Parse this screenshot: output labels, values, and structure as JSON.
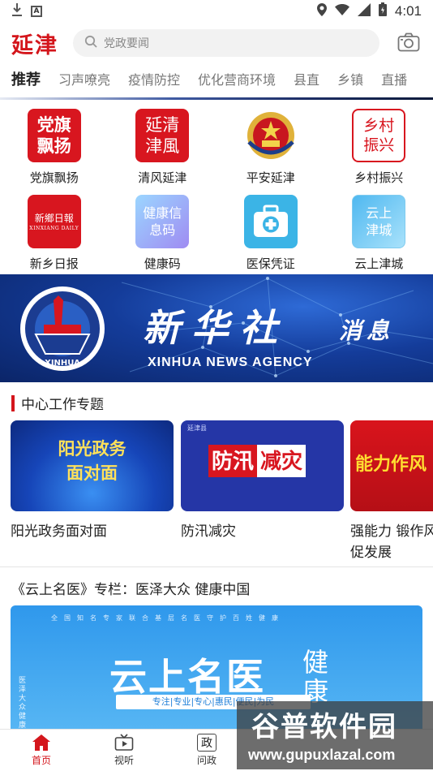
{
  "status_bar": {
    "time": "4:01",
    "notify_a": "A"
  },
  "header": {
    "logo": "延津",
    "search_placeholder": "党政要闻"
  },
  "tabs": [
    "推荐",
    "习声嘹亮",
    "疫情防控",
    "优化营商环境",
    "县直",
    "乡镇",
    "直播"
  ],
  "grid": [
    {
      "label": "党旗飘扬",
      "icon_text": "党旗飘扬",
      "icon": "party-flag-icon"
    },
    {
      "label": "清风延津",
      "icon_text": "延清津風",
      "icon": "clean-wind-icon"
    },
    {
      "label": "平安延津",
      "icon": "police-emblem-icon"
    },
    {
      "label": "乡村振兴",
      "icon_text": "乡村振兴",
      "icon": "rural-revitalization-icon"
    },
    {
      "label": "新乡日报",
      "icon_text": "新鄉日報",
      "icon_sub": "XINXIANG DAILY",
      "icon": "newspaper-icon"
    },
    {
      "label": "健康码",
      "icon_text": "健康信息码",
      "icon": "health-code-icon"
    },
    {
      "label": "医保凭证",
      "icon": "medical-kit-icon"
    },
    {
      "label": "云上津城",
      "icon_text": "云上津城",
      "icon": "cloud-city-icon"
    }
  ],
  "banner": {
    "title": "新华社",
    "title2": "消息",
    "subtitle": "XINHUA NEWS AGENCY",
    "emblem_text": "XINHUA"
  },
  "section": {
    "title": "中心工作专题"
  },
  "topics": [
    {
      "title": "阳光政务面对面",
      "card_line1": "阳光政务",
      "card_line2": "面对面"
    },
    {
      "title": "防汛减灾",
      "card_a": "防汛",
      "card_b": "减灾",
      "card_tag": "延津县"
    },
    {
      "title": "强能力 锻作风 促发展",
      "card_text": "能力作风"
    }
  ],
  "article": {
    "title": "《云上名医》专栏：医泽大众 健康中国",
    "poster_big": "云上名医",
    "poster_side": "健康",
    "poster_strip": "专注|专业|专心|惠民|便民|为民",
    "poster_vert": "医泽大众 健康中",
    "poster_dots": "全国知名专家联合基层名医守护百姓健康"
  },
  "bottom_nav": [
    {
      "label": "首页",
      "icon": "home-icon"
    },
    {
      "label": "视听",
      "icon": "tv-icon"
    },
    {
      "label": "问政",
      "icon": "politics-icon",
      "icon_text": "政"
    }
  ],
  "watermark": {
    "line1": "谷普软件园",
    "line2": "www.gupuxlazal.com"
  },
  "colors": {
    "brand_red": "#d4161c",
    "banner_blue": "#143c9a"
  }
}
